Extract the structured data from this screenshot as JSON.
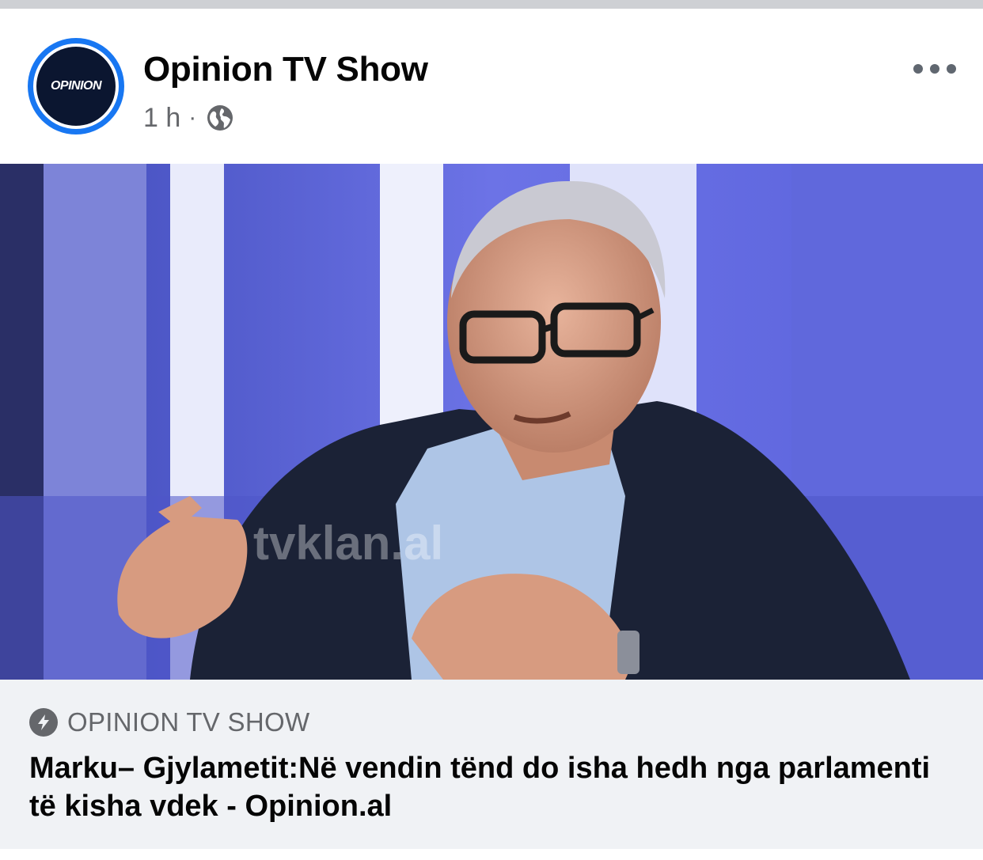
{
  "post": {
    "page_name": "Opinion TV Show",
    "time": "1 h",
    "separator": "·",
    "audience_icon": "globe-icon",
    "avatar_logo_text": "OPINION",
    "more_icon": "more-options-icon"
  },
  "media": {
    "type": "video-thumbnail",
    "watermark": "tvklan.al"
  },
  "link_preview": {
    "source_icon": "instant-article-bolt-icon",
    "source": "OPINION TV SHOW",
    "title": "Marku– Gjylametit:Në vendin tënd do isha hedh nga parlamenti të kisha vdek - Opinion.al"
  },
  "colors": {
    "accent": "#1877f2",
    "secondary_text": "#65676b",
    "link_background": "#f0f2f5",
    "studio_blue": "#5a60d8"
  }
}
